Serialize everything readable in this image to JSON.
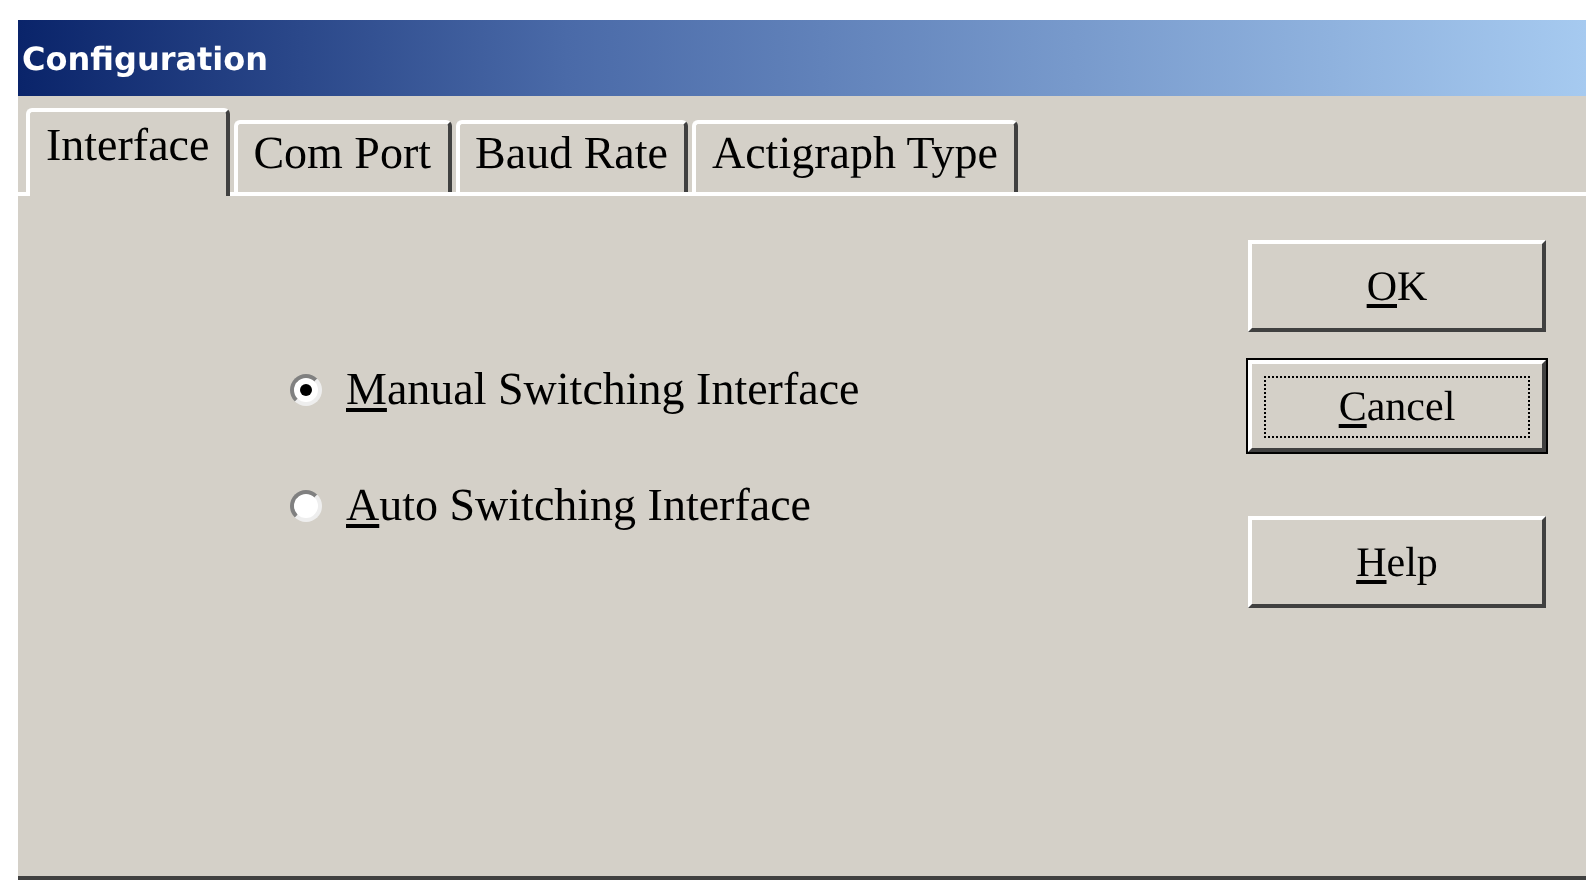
{
  "window": {
    "title": "Configuration"
  },
  "tabs": [
    {
      "label": "Interface",
      "selected": true
    },
    {
      "label": "Com Port",
      "selected": false
    },
    {
      "label": "Baud Rate",
      "selected": false
    },
    {
      "label": "Actigraph Type",
      "selected": false
    }
  ],
  "options": [
    {
      "label": "Manual Switching Interface",
      "selected": true
    },
    {
      "label": "Auto Switching Interface",
      "selected": false
    }
  ],
  "buttons": [
    {
      "label": "OK",
      "focused": false
    },
    {
      "label": "Cancel",
      "focused": true
    },
    {
      "label": "Help",
      "focused": false
    }
  ]
}
